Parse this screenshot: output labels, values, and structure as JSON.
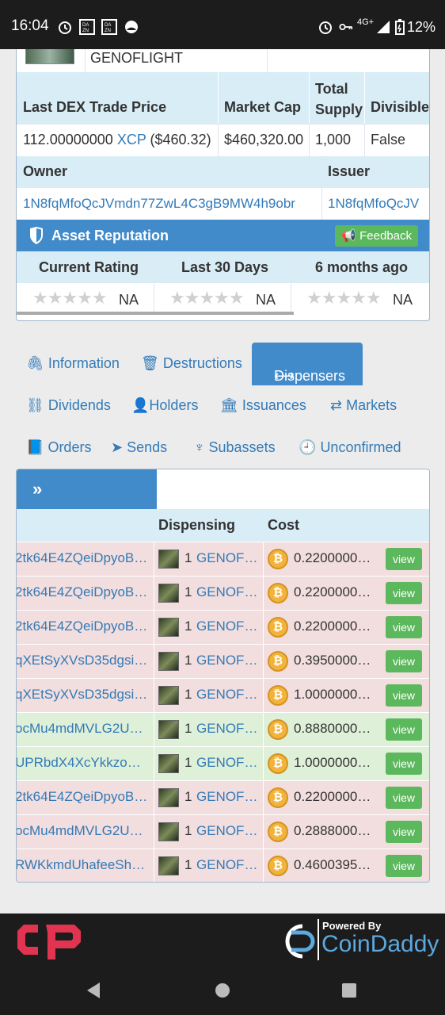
{
  "status_bar": {
    "time": "16:04",
    "network": "4G+",
    "battery": "12%"
  },
  "asset": {
    "name": "GENOFLIGHT",
    "table1_headers": [
      "Last DEX Trade Price",
      "Market Cap",
      "Total Supply",
      "Divisible"
    ],
    "last_price": "112.00000000",
    "last_price_unit": "XCP",
    "last_price_usd": "($460.32)",
    "market_cap": "$460,320.00",
    "total_supply": "1,000",
    "divisible": "False",
    "owner_label": "Owner",
    "issuer_label": "Issuer",
    "owner": "1N8fqMfoQcJVmdn77ZwL4C3gB9MW4h9obr",
    "issuer": "1N8fqMfoQcJV"
  },
  "reputation": {
    "title": "Asset Reputation",
    "feedback_label": "Feedback",
    "headers": [
      "Current Rating",
      "Last 30 Days",
      "6 months ago"
    ],
    "values": [
      "NA",
      "NA",
      "NA"
    ]
  },
  "tabs": {
    "information": "Information",
    "destructions": "Destructions",
    "dispensers": "Dispensers",
    "dividends": "Dividends",
    "holders": "Holders",
    "issuances": "Issuances",
    "markets": "Markets",
    "orders": "Orders",
    "sends": "Sends",
    "subassets": "Subassets",
    "unconfirmed": "Unconfirmed"
  },
  "dispensers": {
    "head_icon": "»",
    "col_dispensing": "Dispensing",
    "col_cost": "Cost",
    "view_label": "view",
    "rows": [
      {
        "addr": "2tk64E4ZQeiDpyoB…",
        "qty": "1",
        "asset": "GENOF…",
        "cost": "0.2200000…",
        "status": "red"
      },
      {
        "addr": "2tk64E4ZQeiDpyoB…",
        "qty": "1",
        "asset": "GENOF…",
        "cost": "0.2200000…",
        "status": "red"
      },
      {
        "addr": "2tk64E4ZQeiDpyoB…",
        "qty": "1",
        "asset": "GENOF…",
        "cost": "0.2200000…",
        "status": "red"
      },
      {
        "addr": "qXEtSyXVsD35dgsi…",
        "qty": "1",
        "asset": "GENOF…",
        "cost": "0.3950000…",
        "status": "red"
      },
      {
        "addr": "qXEtSyXVsD35dgsi…",
        "qty": "1",
        "asset": "GENOF…",
        "cost": "1.0000000…",
        "status": "red"
      },
      {
        "addr": "ocMu4mdMVLG2U…",
        "qty": "1",
        "asset": "GENOF…",
        "cost": "0.8880000…",
        "status": "green"
      },
      {
        "addr": "UPRbdX4XcYkkzo…",
        "qty": "1",
        "asset": "GENOF…",
        "cost": "1.0000000…",
        "status": "green"
      },
      {
        "addr": "2tk64E4ZQeiDpyoB…",
        "qty": "1",
        "asset": "GENOF…",
        "cost": "0.2200000…",
        "status": "red"
      },
      {
        "addr": "ocMu4mdMVLG2U…",
        "qty": "1",
        "asset": "GENOF…",
        "cost": "0.2888000…",
        "status": "red"
      },
      {
        "addr": "RWKkmdUhafeeSh…",
        "qty": "1",
        "asset": "GENOF…",
        "cost": "0.4600395…",
        "status": "red"
      }
    ]
  },
  "footer": {
    "powered_by": "Powered By",
    "brand": "CoinDaddy"
  }
}
